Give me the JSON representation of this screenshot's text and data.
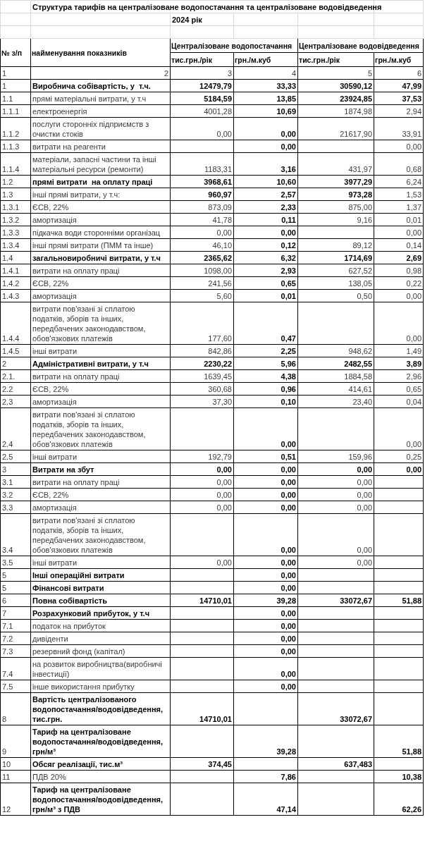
{
  "title": "Структура тарифів на централізоване водопостачання та централізоване водовідведення",
  "year": "2024 рік",
  "header": {
    "number": "№ з/п",
    "name": "найменування показників",
    "groups": [
      {
        "label": "Централізоване водопостачання",
        "units": [
          "тис.грн./рік",
          "грн./м.куб"
        ]
      },
      {
        "label": "Централізоване водовідведення",
        "units": [
          "тис.грн./рік",
          "грн./м.куб"
        ]
      }
    ],
    "column_numbers": [
      "1",
      "2",
      "3",
      "4",
      "5",
      "6"
    ]
  },
  "rows": [
    {
      "no": "1",
      "name": "Виробнича собівартість, у  т.ч.",
      "bold": true,
      "cells": [
        {
          "text": "12479,79",
          "bold": true
        },
        {
          "text": "33,33",
          "bold": true
        },
        {
          "text": "30590,12",
          "bold": true
        },
        {
          "text": "47,99",
          "bold": true
        }
      ]
    },
    {
      "no": "1.1",
      "name": "прямі матеріальні витрати, у т.ч",
      "bold": false,
      "cells": [
        {
          "text": "5184,59",
          "bold": true
        },
        {
          "text": "13,85",
          "bold": true
        },
        {
          "text": "23924,85",
          "bold": true
        },
        {
          "text": "37,53",
          "bold": true
        }
      ]
    },
    {
      "no": "1.1.1",
      "name": "електроенергія",
      "bold": false,
      "cells": [
        {
          "text": "4001,28",
          "bold": false
        },
        {
          "text": "10,69",
          "bold": true
        },
        {
          "text": "1874,98",
          "bold": false
        },
        {
          "text": "2,94",
          "bold": false
        }
      ]
    },
    {
      "no": "1.1.2",
      "name": "послуги сторонніх підприємств з очистки стоків",
      "bold": false,
      "cells": [
        {
          "text": "0,00",
          "bold": false
        },
        {
          "text": "0,00",
          "bold": true
        },
        {
          "text": "21617,90",
          "bold": false
        },
        {
          "text": "33,91",
          "bold": false
        }
      ]
    },
    {
      "no": "1.1.3",
      "name": "витрати на реагенти",
      "bold": false,
      "cells": [
        null,
        {
          "text": "0,00",
          "bold": true
        },
        null,
        {
          "text": "0,00",
          "bold": false
        }
      ]
    },
    {
      "no": "1.1.4",
      "name": "матеріали, запасні частини та інші матеріальні ресурси (ремонти)",
      "bold": false,
      "cells": [
        {
          "text": "1183,31",
          "bold": false
        },
        {
          "text": "3,16",
          "bold": true
        },
        {
          "text": "431,97",
          "bold": false
        },
        {
          "text": "0,68",
          "bold": false
        }
      ]
    },
    {
      "no": "1.2",
      "name": "прямі витрати  на оплату праці",
      "bold": true,
      "cells": [
        {
          "text": "3968,61",
          "bold": true
        },
        {
          "text": "10,60",
          "bold": true
        },
        {
          "text": "3977,29",
          "bold": true
        },
        {
          "text": "6,24",
          "bold": false
        }
      ]
    },
    {
      "no": "1.3",
      "name": "інші прямі витрати, у т.ч:",
      "bold": false,
      "cells": [
        {
          "text": "960,97",
          "bold": true
        },
        {
          "text": "2,57",
          "bold": true
        },
        {
          "text": "973,28",
          "bold": true
        },
        {
          "text": "1,53",
          "bold": false
        }
      ]
    },
    {
      "no": "1.3.1",
      "name": "ЄСВ, 22%",
      "bold": false,
      "cells": [
        {
          "text": "873,09",
          "bold": false
        },
        {
          "text": "2,33",
          "bold": true
        },
        {
          "text": "875,00",
          "bold": false
        },
        {
          "text": "1,37",
          "bold": false
        }
      ]
    },
    {
      "no": "1.3.2",
      "name": "амортизація",
      "bold": false,
      "cells": [
        {
          "text": "41,78",
          "bold": false
        },
        {
          "text": "0,11",
          "bold": true
        },
        {
          "text": "9,16",
          "bold": false
        },
        {
          "text": "0,01",
          "bold": false
        }
      ]
    },
    {
      "no": "1.3.3",
      "name": "підкачка води сторонніми організац",
      "bold": false,
      "cells": [
        {
          "text": "0,00",
          "bold": false
        },
        {
          "text": "0,00",
          "bold": true
        },
        null,
        {
          "text": "0,00",
          "bold": false
        }
      ]
    },
    {
      "no": "1.3.4",
      "name": "інші прямі витрати (ПММ та інше)",
      "bold": false,
      "cells": [
        {
          "text": "46,10",
          "bold": false
        },
        {
          "text": "0,12",
          "bold": true
        },
        {
          "text": "89,12",
          "bold": false
        },
        {
          "text": "0,14",
          "bold": false
        }
      ]
    },
    {
      "no": "1.4",
      "name": "загальновиробничі витрати, у т.ч",
      "bold": true,
      "cells": [
        {
          "text": "2365,62",
          "bold": true
        },
        {
          "text": "6,32",
          "bold": true
        },
        {
          "text": "1714,69",
          "bold": true
        },
        {
          "text": "2,69",
          "bold": true
        }
      ]
    },
    {
      "no": "1.4.1",
      "name": "витрати на оплату праці",
      "bold": false,
      "cells": [
        {
          "text": "1098,00",
          "bold": false
        },
        {
          "text": "2,93",
          "bold": true
        },
        {
          "text": "627,52",
          "bold": false
        },
        {
          "text": "0,98",
          "bold": false
        }
      ]
    },
    {
      "no": "1.4.2",
      "name": "ЄСВ, 22%",
      "bold": false,
      "cells": [
        {
          "text": "241,56",
          "bold": false
        },
        {
          "text": "0,65",
          "bold": true
        },
        {
          "text": "138,05",
          "bold": false
        },
        {
          "text": "0,22",
          "bold": false
        }
      ]
    },
    {
      "no": "1.4.3",
      "name": "амортизація",
      "bold": false,
      "cells": [
        {
          "text": "5,60",
          "bold": false
        },
        {
          "text": "0,01",
          "bold": true
        },
        {
          "text": "0,50",
          "bold": false
        },
        {
          "text": "0,00",
          "bold": false
        }
      ]
    },
    {
      "no": "1.4.4",
      "name": "витрати пов'язані зі сплатою податків, зборів та інших, передбачених законодавством, обов'язкових платежів",
      "bold": false,
      "cells": [
        {
          "text": "177,60",
          "bold": false
        },
        {
          "text": "0,47",
          "bold": true
        },
        null,
        {
          "text": "0,00",
          "bold": false
        }
      ]
    },
    {
      "no": "1.4.5",
      "name": "інші витрати",
      "bold": false,
      "cells": [
        {
          "text": "842,86",
          "bold": false
        },
        {
          "text": "2,25",
          "bold": true
        },
        {
          "text": "948,62",
          "bold": false
        },
        {
          "text": "1,49",
          "bold": false
        }
      ]
    },
    {
      "no": "2",
      "name": "Адміністративні витрати, у т.ч",
      "bold": true,
      "cells": [
        {
          "text": "2230,22",
          "bold": true
        },
        {
          "text": "5,96",
          "bold": true
        },
        {
          "text": "2482,55",
          "bold": true
        },
        {
          "text": "3,89",
          "bold": true
        }
      ]
    },
    {
      "no": "2.1.",
      "name": "витрати на оплату праці",
      "bold": false,
      "cells": [
        {
          "text": "1639,45",
          "bold": false
        },
        {
          "text": "4,38",
          "bold": true
        },
        {
          "text": "1884,58",
          "bold": false
        },
        {
          "text": "2,96",
          "bold": false
        }
      ]
    },
    {
      "no": "2.2",
      "name": "ЄСВ, 22%",
      "bold": false,
      "cells": [
        {
          "text": "360,68",
          "bold": false
        },
        {
          "text": "0,96",
          "bold": true
        },
        {
          "text": "414,61",
          "bold": false
        },
        {
          "text": "0,65",
          "bold": false
        }
      ]
    },
    {
      "no": "2.3",
      "name": "амортизація",
      "bold": false,
      "cells": [
        {
          "text": "37,30",
          "bold": false
        },
        {
          "text": "0,10",
          "bold": true
        },
        {
          "text": "23,40",
          "bold": false
        },
        {
          "text": "0,04",
          "bold": false
        }
      ]
    },
    {
      "no": "2.4",
      "name": "витрати пов'язані зі сплатою податків, зборів та інших, передбачених законодавством, обов'язкових платежів",
      "bold": false,
      "cells": [
        null,
        {
          "text": "0,00",
          "bold": true
        },
        null,
        {
          "text": "0,00",
          "bold": false
        }
      ]
    },
    {
      "no": "2.5",
      "name": "інші витрати",
      "bold": false,
      "cells": [
        {
          "text": "192,79",
          "bold": false
        },
        {
          "text": "0,51",
          "bold": true
        },
        {
          "text": "159,96",
          "bold": false
        },
        {
          "text": "0,25",
          "bold": false
        }
      ]
    },
    {
      "no": "3",
      "name": "Витрати на збут",
      "bold": true,
      "cells": [
        {
          "text": "0,00",
          "bold": true
        },
        {
          "text": "0,00",
          "bold": true
        },
        {
          "text": "0,00",
          "bold": true
        },
        {
          "text": "0,00",
          "bold": true
        }
      ]
    },
    {
      "no": "3.1",
      "name": "витрати на оплату праці",
      "bold": false,
      "cells": [
        {
          "text": "0,00",
          "bold": false
        },
        {
          "text": "0,00",
          "bold": true
        },
        {
          "text": "0,00",
          "bold": false
        },
        null
      ]
    },
    {
      "no": "3.2",
      "name": "ЄСВ, 22%",
      "bold": false,
      "cells": [
        {
          "text": "0,00",
          "bold": false
        },
        {
          "text": "0,00",
          "bold": true
        },
        {
          "text": "0,00",
          "bold": false
        },
        null
      ]
    },
    {
      "no": "3.3",
      "name": "амортизація",
      "bold": false,
      "cells": [
        {
          "text": "0,00",
          "bold": false
        },
        {
          "text": "0,00",
          "bold": true
        },
        {
          "text": "0,00",
          "bold": false
        },
        null
      ]
    },
    {
      "no": "3.4",
      "name": "витрати пов'язані зі сплатою податків, зборів та інших, передбачених законодавством, обов'язкових платежів",
      "bold": false,
      "cells": [
        null,
        {
          "text": "0,00",
          "bold": true
        },
        {
          "text": "0,00",
          "bold": false
        },
        null
      ]
    },
    {
      "no": "3.5",
      "name": "інші витрати",
      "bold": false,
      "cells": [
        {
          "text": "0,00",
          "bold": false
        },
        {
          "text": "0,00",
          "bold": true
        },
        {
          "text": "0,00",
          "bold": false
        },
        null
      ]
    },
    {
      "no": "5",
      "name": "Інші операційні витрати",
      "bold": true,
      "cells": [
        null,
        {
          "text": "0,00",
          "bold": true
        },
        null,
        null
      ]
    },
    {
      "no": "5",
      "name": "Фінансові витрати",
      "bold": true,
      "cells": [
        null,
        {
          "text": "0,00",
          "bold": true
        },
        null,
        null
      ]
    },
    {
      "no": "6",
      "name": "Повна собівартість",
      "bold": true,
      "cells": [
        {
          "text": "14710,01",
          "bold": true
        },
        {
          "text": "39,28",
          "bold": true
        },
        {
          "text": "33072,67",
          "bold": true
        },
        {
          "text": "51,88",
          "bold": true
        }
      ]
    },
    {
      "no": "7",
      "name": "Розрахунковий прибуток, у т.ч",
      "bold": true,
      "cells": [
        null,
        {
          "text": "0,00",
          "bold": true
        },
        null,
        null
      ]
    },
    {
      "no": "7.1",
      "name": "податок на прибуток",
      "bold": false,
      "cells": [
        null,
        {
          "text": "0,00",
          "bold": true
        },
        null,
        null
      ]
    },
    {
      "no": "7.2",
      "name": "дивіденти",
      "bold": false,
      "cells": [
        null,
        {
          "text": "0,00",
          "bold": true
        },
        null,
        null
      ]
    },
    {
      "no": "7.3",
      "name": "резервний фонд (капітал)",
      "bold": false,
      "cells": [
        null,
        {
          "text": "0,00",
          "bold": true
        },
        null,
        null
      ]
    },
    {
      "no": "7.4",
      "name": "на розвиток виробництва(виробничі інвестиції)",
      "bold": false,
      "cells": [
        null,
        {
          "text": "0,00",
          "bold": true
        },
        null,
        null
      ]
    },
    {
      "no": "7.5",
      "name": "інше використання прибутку",
      "bold": false,
      "cells": [
        null,
        {
          "text": "0,00",
          "bold": true
        },
        null,
        null
      ]
    },
    {
      "no": "8",
      "name": "Вартість централізованого водопостачання/водовідведення, тис.грн.",
      "bold": true,
      "cells": [
        {
          "text": "14710,01",
          "bold": true
        },
        null,
        {
          "text": "33072,67",
          "bold": true
        },
        null
      ]
    },
    {
      "no": "9",
      "name": "Тариф на централізоване водопостачання/водовідведення, грн/м³",
      "bold": true,
      "cells": [
        null,
        {
          "text": "39,28",
          "bold": true
        },
        null,
        {
          "text": "51,88",
          "bold": true
        }
      ]
    },
    {
      "no": "10",
      "name": "Обсяг реалізації, тис.м³",
      "bold": true,
      "cells": [
        {
          "text": "374,45",
          "bold": true
        },
        null,
        {
          "text": "637,483",
          "bold": true
        },
        null
      ]
    },
    {
      "no": "11",
      "name": "ПДВ 20%",
      "bold": false,
      "cells": [
        null,
        {
          "text": "7,86",
          "bold": true
        },
        null,
        {
          "text": "10,38",
          "bold": true
        }
      ]
    },
    {
      "no": "12",
      "name": "Тариф на централізоване водопостачання/водовідведення, грн/м³ з ПДВ",
      "bold": true,
      "cells": [
        null,
        {
          "text": "47,14",
          "bold": true
        },
        null,
        {
          "text": "62,26",
          "bold": true
        }
      ]
    }
  ]
}
